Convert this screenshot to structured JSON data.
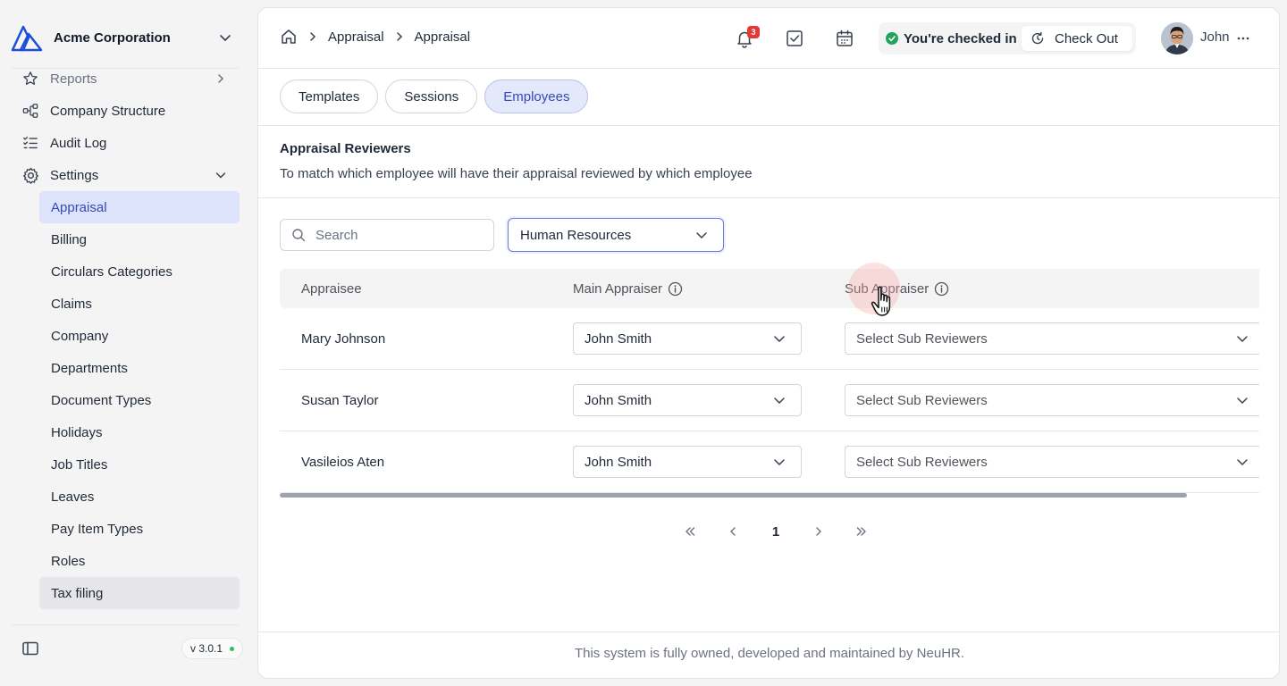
{
  "org": {
    "name": "Acme Corporation"
  },
  "sidebar": {
    "partial_item": "Reports",
    "items": [
      {
        "label": "Company Structure",
        "icon": "hierarchy-icon"
      },
      {
        "label": "Audit Log",
        "icon": "checklist-icon"
      },
      {
        "label": "Settings",
        "icon": "gear-icon"
      }
    ],
    "settings_sub": [
      "Appraisal",
      "Billing",
      "Circulars Categories",
      "Claims",
      "Company",
      "Departments",
      "Document Types",
      "Holidays",
      "Job Titles",
      "Leaves",
      "Pay Item Types",
      "Roles",
      "Tax filing"
    ],
    "active_sub": "Appraisal",
    "hover_sub": "Tax filing",
    "version": "v 3.0.1"
  },
  "header": {
    "breadcrumbs": [
      "Appraisal",
      "Appraisal"
    ],
    "notification_count": "3",
    "checkin_status": "You're checked in",
    "checkout_label": "Check Out",
    "user_name": "John"
  },
  "tabs": [
    {
      "label": "Templates",
      "active": false
    },
    {
      "label": "Sessions",
      "active": false
    },
    {
      "label": "Employees",
      "active": true
    }
  ],
  "section": {
    "title": "Appraisal Reviewers",
    "description": "To match which employee will have their appraisal reviewed by which employee"
  },
  "filters": {
    "search_placeholder": "Search",
    "department": "Human Resources"
  },
  "table": {
    "columns": [
      "Appraisee",
      "Main Appraiser",
      "Sub Appraiser"
    ],
    "rows": [
      {
        "appraisee": "Mary Johnson",
        "main": "John Smith",
        "sub_placeholder": "Select Sub Reviewers"
      },
      {
        "appraisee": "Susan Taylor",
        "main": "John Smith",
        "sub_placeholder": "Select Sub Reviewers"
      },
      {
        "appraisee": "Vasileios Aten",
        "main": "John Smith",
        "sub_placeholder": "Select Sub Reviewers"
      }
    ]
  },
  "pagination": {
    "current_page": "1"
  },
  "footer": {
    "text": "This system is fully owned, developed and maintained by NeuHR."
  },
  "colors": {
    "accent": "#3449b8",
    "active_bg": "#dde3fb",
    "success": "#22a55a",
    "badge": "#e53935"
  }
}
